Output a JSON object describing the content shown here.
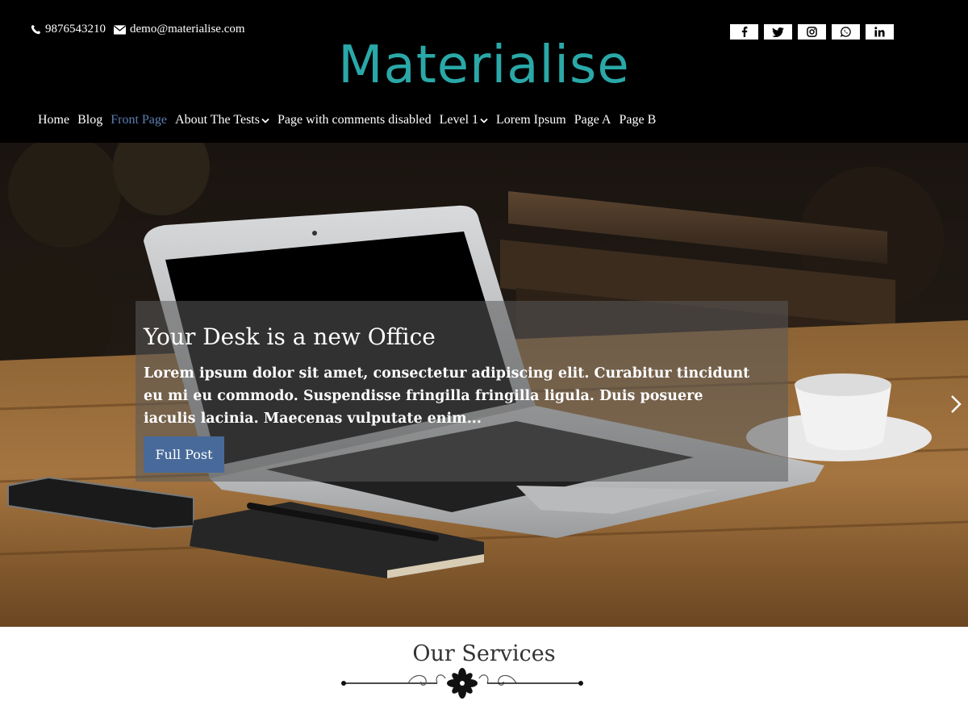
{
  "header": {
    "phone": "9876543210",
    "email": "demo@materialise.com",
    "logo": "Materialise",
    "social": [
      {
        "name": "facebook",
        "icon": "facebook-icon"
      },
      {
        "name": "twitter",
        "icon": "twitter-icon"
      },
      {
        "name": "instagram",
        "icon": "instagram-icon"
      },
      {
        "name": "whatsapp",
        "icon": "whatsapp-icon"
      },
      {
        "name": "linkedin",
        "icon": "linkedin-icon"
      }
    ]
  },
  "nav": {
    "items": [
      {
        "label": "Home"
      },
      {
        "label": "Blog"
      },
      {
        "label": "Front Page",
        "active": true
      },
      {
        "label": "About The Tests",
        "dropdown": true
      },
      {
        "label": "Page with comments disabled"
      },
      {
        "label": "Level 1",
        "dropdown": true
      },
      {
        "label": "Lorem Ipsum"
      },
      {
        "label": "Page A"
      },
      {
        "label": "Page B"
      }
    ]
  },
  "slider": {
    "title": "Your Desk is a new Office",
    "excerpt": "Lorem ipsum dolor sit amet, consectetur adipiscing elit. Curabitur tincidunt eu mi eu commodo. Suspendisse fringilla fringilla ligula. Duis posuere iaculis lacinia. Maecenas vulputate enim...",
    "button": "Full Post",
    "next_icon": "chevron-right-icon"
  },
  "services": {
    "title": "Our Services"
  },
  "colors": {
    "header_bg": "#000000",
    "logo": "#2aa8a8",
    "active_nav": "#5b7fb5",
    "button": "#486a9a"
  }
}
